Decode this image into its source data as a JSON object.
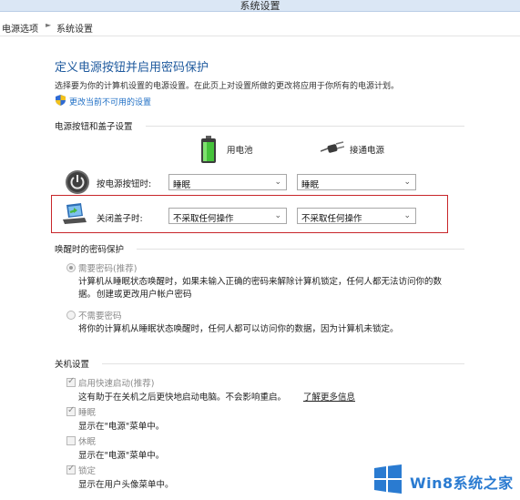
{
  "window": {
    "title": "系统设置"
  },
  "breadcrumb": {
    "items": [
      "电源选项",
      "系统设置"
    ]
  },
  "page": {
    "title": "定义电源按钮并启用密码保护",
    "description": "选择要为你的计算机设置的电源设置。在此页上对设置所做的更改将应用于你所有的电源计划。",
    "change_link": "更改当前不可用的设置"
  },
  "power_section": {
    "title": "电源按钮和盖子设置",
    "columns": {
      "battery": "用电池",
      "plugged": "接通电源"
    },
    "rows": [
      {
        "label": "按电源按钮时:",
        "battery_value": "睡眠",
        "plugged_value": "睡眠"
      },
      {
        "label": "关闭盖子时:",
        "battery_value": "不采取任何操作",
        "plugged_value": "不采取任何操作"
      }
    ]
  },
  "password_section": {
    "title": "唤醒时的密码保护",
    "options": [
      {
        "label": "需要密码(推荐)",
        "selected": true,
        "desc_1": "计算机从睡眠状态唤醒时，如果未输入正确的密码来解除计算机锁定，任何人都无法访问你的数",
        "desc_2": "据。",
        "link": "创建或更改用户帐户密码"
      },
      {
        "label": "不需要密码",
        "selected": false,
        "desc_1": "将你的计算机从睡眠状态唤醒时，任何人都可以访问你的数据，因为计算机未锁定。"
      }
    ]
  },
  "shutdown_section": {
    "title": "关机设置",
    "items": [
      {
        "label": "启用快速启动(推荐)",
        "checked": true,
        "desc": "这有助于在关机之后更快地启动电脑。不会影响重启。",
        "link": "了解更多信息"
      },
      {
        "label": "睡眠",
        "checked": true,
        "desc": "显示在\"电源\"菜单中。"
      },
      {
        "label": "休眠",
        "checked": false,
        "desc": "显示在\"电源\"菜单中。"
      },
      {
        "label": "锁定",
        "checked": true,
        "desc": "显示在用户头像菜单中。"
      }
    ]
  },
  "watermark": {
    "text": "Win8系统之家"
  },
  "colors": {
    "title_blue": "#1f5a9e",
    "link_blue": "#1f6fc5",
    "highlight_red": "#c8262a",
    "watermark_blue": "#2a7bd1"
  }
}
